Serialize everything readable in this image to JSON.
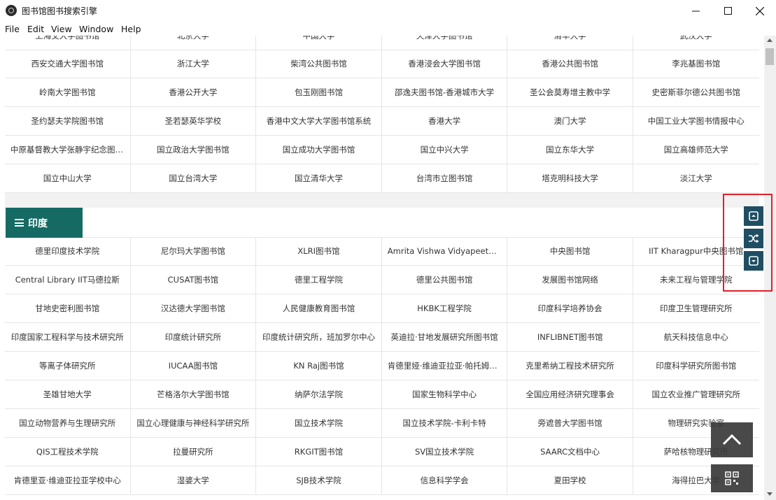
{
  "window": {
    "title": "图书馆图书搜索引擎"
  },
  "menu": [
    "File",
    "Edit",
    "View",
    "Window",
    "Help"
  ],
  "top_partial_row": [
    "上海交大学图书馆",
    "北京大学",
    "中国大学",
    "天津大学图书馆",
    "清华大学",
    "武汉大学"
  ],
  "top_rows": [
    [
      "西安交通大学图书馆",
      "浙江大学",
      "柴湾公共图书馆",
      "香港浸会大学图书馆",
      "香港公共图书馆",
      "李兆基图书馆"
    ],
    [
      "岭南大学图书馆",
      "香港公开大学",
      "包玉刚图书馆",
      "邵逸夫图书馆-香港城市大学",
      "圣公会莫寿增主教中学",
      "史密斯菲尔德公共图书馆"
    ],
    [
      "圣约瑟夫学院图书馆",
      "圣若瑟英华学校",
      "香港中文大学大学图书馆系统",
      "香港大学",
      "澳门大学",
      "中国工业大学图书情报中心"
    ],
    [
      "中原基督教大学张静宇纪念图书馆",
      "国立政治大学图书馆",
      "国立成功大学图书馆",
      "国立中兴大学",
      "国立东华大学",
      "国立高雄师范大学"
    ],
    [
      "国立中山大学",
      "国立台湾大学",
      "国立清华大学",
      "台湾市立图书馆",
      "塔克明科技大学",
      "淡江大学"
    ]
  ],
  "section": {
    "title": "印度"
  },
  "india_rows": [
    [
      "德里印度技术学院",
      "尼尔玛大学图书馆",
      "XLRI图书馆",
      "Amrita Vishwa Vidyapeetham图书馆",
      "中央图书馆",
      "IIT Kharagpur中央图书馆"
    ],
    [
      "Central Library IIT马德拉斯",
      "CUSAT图书馆",
      "德里工程学院",
      "德里公共图书馆",
      "发展图书馆网络",
      "未来工程与管理学院"
    ],
    [
      "甘地史密利图书馆",
      "汉达德大学图书馆",
      "人民健康教育图书馆",
      "HKBK工程学院",
      "印度科学培养协会",
      "印度卫生管理研究所"
    ],
    [
      "印度国家工程科学与技术研究所",
      "印度统计研究所",
      "印度统计研究所，班加罗尔中心",
      "英迪拉·甘地发展研究所图书馆",
      "INFLIBNET图书馆",
      "航天科技信息中心"
    ],
    [
      "等离子体研究所",
      "IUCAA图书馆",
      "KN Raj图书馆",
      "肯德里娅·维迪亚拉亚·帕托姆学校",
      "克里希纳工程技术研究所",
      "印度科学研究所图书馆"
    ],
    [
      "圣雄甘地大学",
      "芒格洛尔大学图书馆",
      "纳萨尔法学院",
      "国家生物科学中心",
      "全国应用经济研究理事会",
      "国立农业推广管理研究所"
    ],
    [
      "国立动物营养与生理研究所",
      "国立心理健康与神经科学研究所",
      "国立技术学院",
      "国立技术学院-卡利卡特",
      "旁遮普大学图书馆",
      "物理研究实验室"
    ],
    [
      "QIS工程技术学院",
      "拉曼研究所",
      "RKGIT图书馆",
      "SV国立技术学院",
      "SAARC文档中心",
      "萨哈核物理研究所"
    ],
    [
      "肯德里亚·维迪亚拉亚学校中心",
      "湿婆大学",
      "SJB技术学院",
      "信息科学学会",
      "夏田学校",
      "海得拉巴大学"
    ]
  ],
  "float_icons": [
    "collapse-up-icon",
    "shuffle-icon",
    "collapse-down-icon"
  ],
  "colors": {
    "section_tab": "#156b64",
    "float_button": "#1f4e63",
    "highlight_box": "#e0202a"
  }
}
